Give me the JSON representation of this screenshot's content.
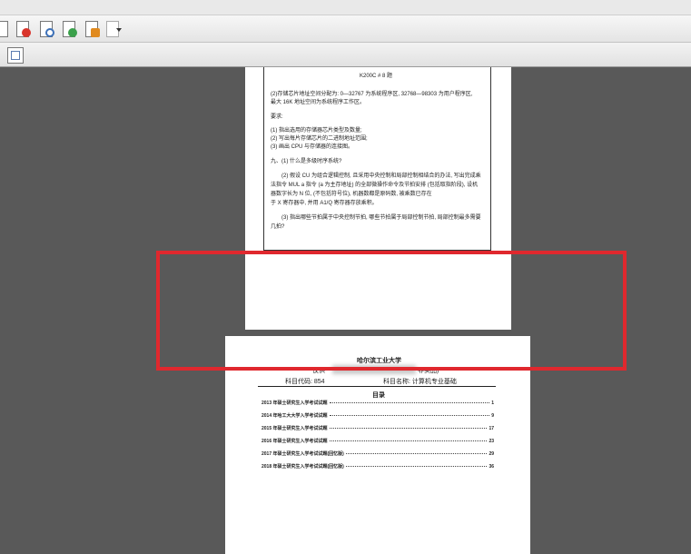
{
  "toolbar": {
    "icons": [
      "forward-icon",
      "delete-pdf-icon",
      "search-doc-icon",
      "export-icon",
      "edit-sign-icon",
      "settings-icon"
    ],
    "colors": {
      "red": "#d9342b",
      "green": "#3aa04a",
      "blue": "#3c70b8",
      "orange": "#e08a1e"
    }
  },
  "page1": {
    "header": "K200C # 8 题",
    "q2_line1": "(2)存储芯片地址空间分配为: 0—32767 为系统程序区, 32768—98303 为用户程序区,",
    "q2_line2": "最大 16K 地址空间为系统程序工作区。",
    "req_label": "要求:",
    "req1": "(1)   指出选用的存储器芯片类型及数量;",
    "req2": "(2)   写出每片存储芯片的二进制地址范围;",
    "req3": "(3)   画出 CPU 与存储器的连接图。",
    "q9_title": "九、(1) 什么是多级时序系统?",
    "q9_2a": "(2) 假设 CU 为组合逻辑控制, 且采用中央控制和局部控制相结合的办法, 写出完成乘",
    "q9_2b": "法指令 MUL a 指令 (a 为主存地址) 的全部微操作命令及节拍安排 (包括取指阶段), 设机",
    "q9_2c": "器数字长为 N 位, (不包括符号位), 机器数都是原码数, 被乘数已存在",
    "q9_2d": "于 X 寄存器中, 并用 A1/Q 寄存器存放乘积。",
    "q9_3a": "(3) 指出哪些节拍属于中央控制节拍, 哪些节拍属于局部控制节拍, 局部控制最多需要",
    "q9_3b": "几拍?"
  },
  "page2": {
    "university": "哈尔滨工业大学",
    "copy_prefix": "仅供",
    "copy_suffix": "非卖品)",
    "code_label": "科目代码: 854",
    "subject_label": "科目名称: 计算机专业基础",
    "toc_title": "目录",
    "toc": [
      {
        "title": "2013 年硕士研究生入学考试试题",
        "page": "1"
      },
      {
        "title": "2014 年哈工大大学入学考试试题",
        "page": "9"
      },
      {
        "title": "2015 年硕士研究生入学考试试题",
        "page": "17"
      },
      {
        "title": "2016 年硕士研究生入学考试试题",
        "page": "23"
      },
      {
        "title": "2017 年硕士研究生入学考试试题(回忆版)",
        "page": "29"
      },
      {
        "title": "2018 年硕士研究生入学考试试题(回忆版)",
        "page": "36"
      }
    ]
  },
  "highlight": {
    "color": "#e0282e"
  }
}
